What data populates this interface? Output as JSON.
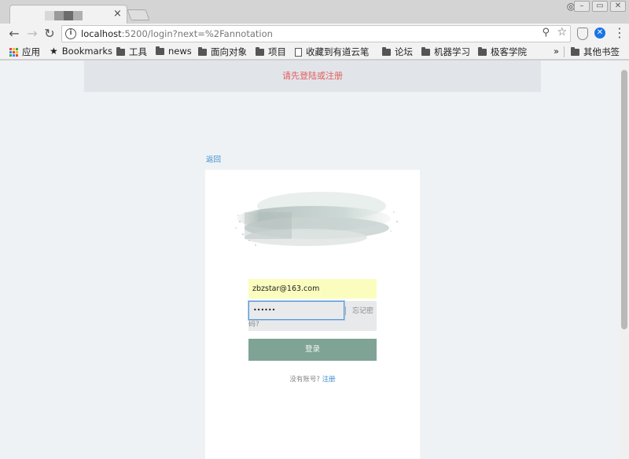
{
  "browser": {
    "tab": {
      "close_glyph": "×"
    },
    "address": {
      "host": "localhost",
      "rest": ":5200/login?next=%2Fannotation"
    },
    "bookmarks": [
      {
        "label": "应用",
        "icon": "apps-icon"
      },
      {
        "label": "Bookmarks",
        "icon": "star-icon"
      },
      {
        "label": "工具",
        "icon": "folder-icon"
      },
      {
        "label": "news",
        "icon": "folder-icon"
      },
      {
        "label": "面向对象",
        "icon": "folder-icon"
      },
      {
        "label": "项目",
        "icon": "folder-icon"
      },
      {
        "label": "收藏到有道云笔",
        "icon": "page-icon"
      },
      {
        "label": "论坛",
        "icon": "folder-icon"
      },
      {
        "label": "机器学习",
        "icon": "folder-icon"
      },
      {
        "label": "极客学院",
        "icon": "folder-icon"
      }
    ],
    "overflow": "»",
    "other_bookmarks": "其他书签"
  },
  "page": {
    "alert": "请先登陆或注册",
    "back_link": "返回",
    "form": {
      "email_value": "zbzstar@163.com",
      "password_mask": "••••••",
      "forgot_a": "忘记密",
      "forgot_b": "码?",
      "login_button": "登录",
      "no_account": "没有账号?",
      "register_link": "注册"
    }
  },
  "colors": {
    "alert_text": "#e35b5b",
    "link": "#3d8ed1",
    "login_button": "#7fa395",
    "email_autofill_bg": "#fbfdbf"
  }
}
